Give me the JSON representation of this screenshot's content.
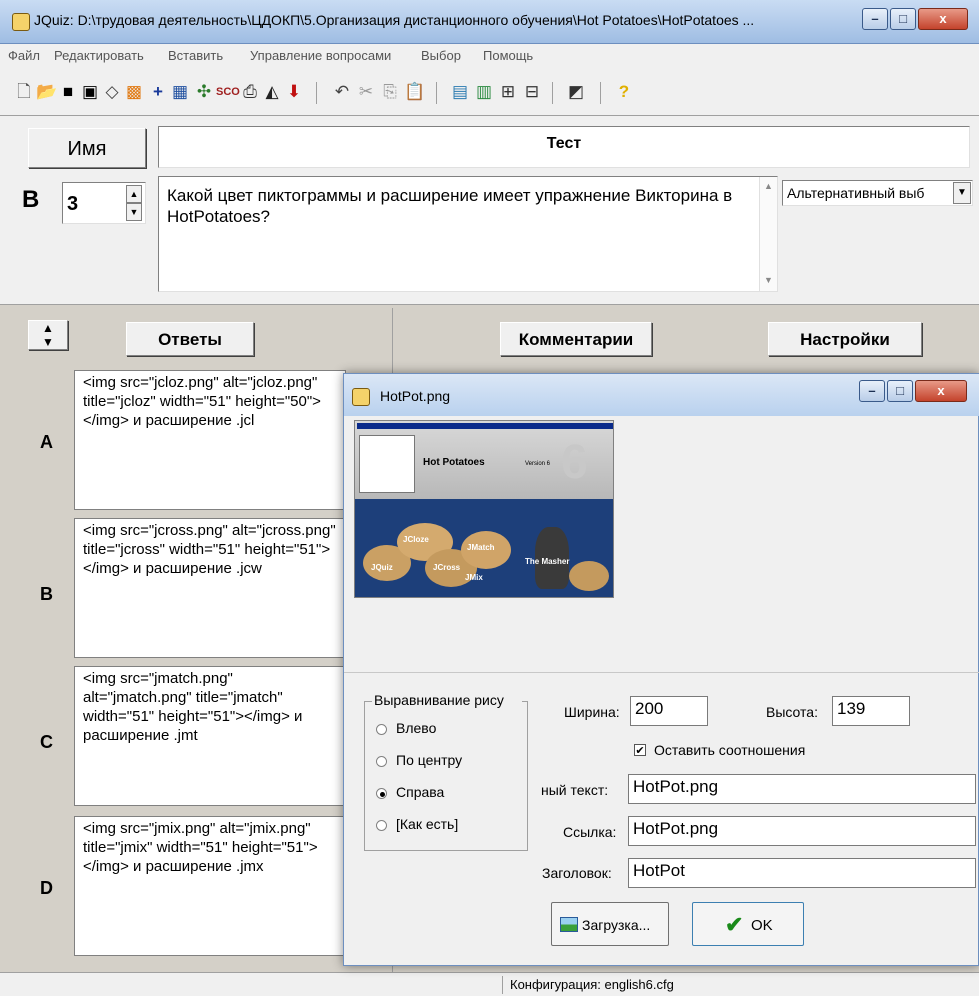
{
  "window": {
    "title": "JQuiz: D:\\трудовая деятельность\\ЦДОКП\\5.Организация дистанционного обучения\\Hot Potatoes\\HotPotatoes ...",
    "minimize": "–",
    "maximize": "□",
    "close": "x"
  },
  "menu": [
    "Файл",
    "Редактировать",
    "Вставить",
    "Управление вопросами",
    "Выбор",
    "Помощь"
  ],
  "toolbar_icons": [
    "new-file-icon",
    "open-folder-icon",
    "save-icon",
    "save-as-icon",
    "eraser-icon",
    "web-page-icon",
    "add-icon",
    "crossword-icon",
    "tree-icon",
    "scorm-icon",
    "printer-icon",
    "export-icon",
    "arrow-down-icon",
    "undo-icon",
    "cut-icon",
    "copy-icon",
    "paste-icon",
    "image-icon",
    "insert-image-icon",
    "link-icon",
    "grid-icon",
    "config-icon",
    "help-icon"
  ],
  "header": {
    "name_button": "Имя",
    "title_value": "Тест",
    "question_label": "В",
    "question_number": "3",
    "question_text": "Какой цвет пиктограммы и расширение имеет упражнение Викторина в HotPotatoes?",
    "question_type": "Альтернативный выб"
  },
  "columns": {
    "answers": "Ответы",
    "comments": "Комментарии",
    "settings": "Настройки"
  },
  "answers": [
    {
      "letter": "A",
      "text": "<img src=\"jcloz.png\" alt=\"jcloz.png\" title=\"jcloz\" width=\"51\" height=\"50\"></img> и расширение .jcl"
    },
    {
      "letter": "B",
      "text": "<img src=\"jcross.png\" alt=\"jcross.png\" title=\"jcross\" width=\"51\" height=\"51\"></img> и расширение .jcw"
    },
    {
      "letter": "C",
      "text": "<img src=\"jmatch.png\" alt=\"jmatch.png\" title=\"jmatch\" width=\"51\" height=\"51\"></img> и расширение .jmt"
    },
    {
      "letter": "D",
      "text": "<img src=\"jmix.png\" alt=\"jmix.png\" title=\"jmix\" width=\"51\" height=\"51\"></img> и расширение .jmx"
    }
  ],
  "status": {
    "config": "Конфигурация: english6.cfg"
  },
  "dialog": {
    "title": "HotPot.png",
    "preview": {
      "app_title": "Hot Potatoes",
      "version": "Version 6",
      "big_number": "6",
      "potatoes": [
        "JCloze",
        "JMatch",
        "JQuiz",
        "JCross",
        "JMix",
        "The Masher"
      ]
    },
    "align_group": "Выравнивание рису",
    "align_options": [
      "Влево",
      "По центру",
      "Справа",
      "[Как есть]"
    ],
    "align_selected": "Справа",
    "width_label": "Ширина:",
    "width_value": "200",
    "height_label": "Высота:",
    "height_value": "139",
    "keep_ratio": "Оставить соотношения",
    "keep_ratio_checked": true,
    "alt_label": "ный текст:",
    "alt_value": "HotPot.png",
    "link_label": "Ссылка:",
    "link_value": "HotPot.png",
    "caption_label": "Заголовок:",
    "caption_value": "HotPot",
    "load_button": "Загрузка...",
    "ok_button": "OK"
  }
}
